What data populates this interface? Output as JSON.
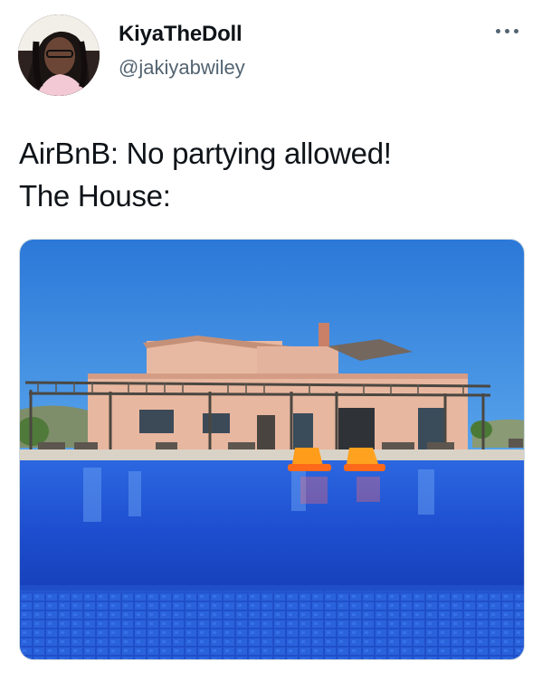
{
  "tweet": {
    "author": {
      "display_name": "KiyaTheDoll",
      "handle": "@jakiyabwiley",
      "avatar_icon": "profile-avatar"
    },
    "more_icon": "more-horizontal-icon",
    "text_lines": [
      "AirBnB: No partying allowed!",
      "The House:"
    ],
    "media": {
      "type": "photo",
      "subject": "villa-with-swimming-pool"
    }
  },
  "colors": {
    "text_primary": "#0f1419",
    "text_secondary": "#536471",
    "sky": "#2f7fd8",
    "pool": "#1f56d6"
  }
}
